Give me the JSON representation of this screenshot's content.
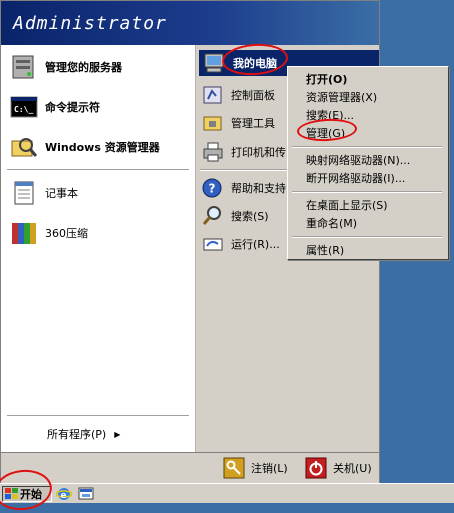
{
  "header": {
    "username": "Administrator"
  },
  "left_items": [
    {
      "label": "管理您的服务器",
      "icon": "server-icon"
    },
    {
      "label": "命令提示符",
      "icon": "command-prompt-icon"
    },
    {
      "label": "Windows 资源管理器",
      "icon": "explorer-icon"
    },
    {
      "label": "记事本",
      "icon": "notepad-icon"
    },
    {
      "label": "360压缩",
      "icon": "archive-icon"
    }
  ],
  "all_programs": "所有程序(P)",
  "right_items": [
    {
      "label": "我的电脑",
      "icon": "my-computer-icon"
    },
    {
      "label": "控制面板",
      "icon": "control-panel-icon"
    },
    {
      "label": "管理工具",
      "icon": "admin-tools-icon"
    },
    {
      "label": "打印机和传",
      "icon": "printer-icon"
    },
    {
      "label": "帮助和支持",
      "icon": "help-icon"
    },
    {
      "label": "搜索(S)",
      "icon": "search-icon"
    },
    {
      "label": "运行(R)...",
      "icon": "run-icon"
    }
  ],
  "context_menu": [
    {
      "label": "打开(O)"
    },
    {
      "label": "资源管理器(X)"
    },
    {
      "label": "搜索(E)..."
    },
    {
      "label": "管理(G)"
    },
    {
      "label": "映射网络驱动器(N)..."
    },
    {
      "label": "断开网络驱动器(I)..."
    },
    {
      "label": "在桌面上显示(S)"
    },
    {
      "label": "重命名(M)"
    },
    {
      "label": "属性(R)"
    }
  ],
  "bottom": {
    "logoff": "注销(L)",
    "shutdown": "关机(U)"
  },
  "taskbar": {
    "start_label": "开始"
  },
  "colors": {
    "header": "#0a246a",
    "highlight": "#0a246a",
    "annotation": "#e01010",
    "desktop": "#3a6ea5"
  }
}
